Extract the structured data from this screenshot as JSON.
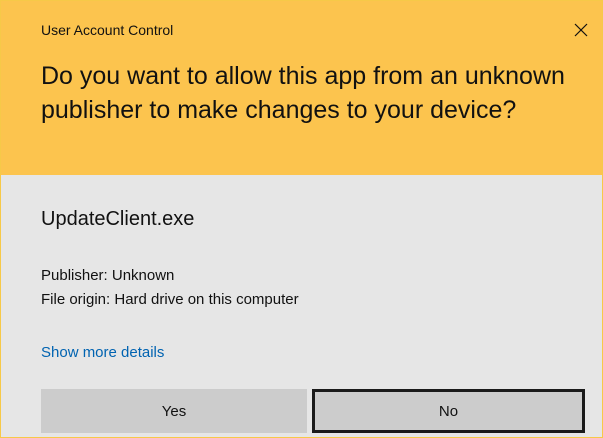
{
  "dialog": {
    "title": "User Account Control",
    "close_icon": "close-icon",
    "question": "Do you want to allow this app from an unknown publisher to make changes to your device?",
    "app_name": "UpdateClient.exe",
    "publisher": "Publisher: Unknown",
    "file_origin": "File origin: Hard drive on this computer",
    "details_link": "Show more details",
    "yes_label": "Yes",
    "no_label": "No"
  },
  "colors": {
    "header_background": "#fcc44e",
    "body_background": "#e6e6e6",
    "button_background": "#cccccc",
    "link": "#0063b1",
    "focus_border": "#1a1a1a"
  }
}
